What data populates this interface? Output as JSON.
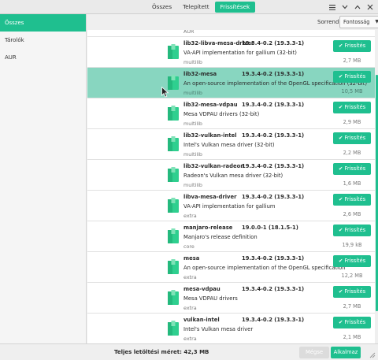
{
  "header": {
    "tabs": [
      {
        "label": "Összes",
        "active": false
      },
      {
        "label": "Telepített",
        "active": false
      },
      {
        "label": "Frissítések",
        "active": true
      }
    ],
    "window_buttons": [
      "menu-icon",
      "minimize-icon",
      "maximize-icon",
      "close-icon"
    ]
  },
  "sidebar": {
    "items": [
      {
        "label": "Összes",
        "active": true
      },
      {
        "label": "Tárolók",
        "active": false
      },
      {
        "label": "AUR",
        "active": false
      }
    ]
  },
  "sort": {
    "label": "Sorrend",
    "value": "Fontosság"
  },
  "packages": {
    "partial_repo_top": "AUR",
    "update_label": "Frissítés",
    "check_glyph": "✔",
    "items": [
      {
        "name": "lib32-libva-mesa-driver",
        "version": "19.3.4-0.2  (19.3.3-1)",
        "description": "VA-API implementation for gallium (32-bit)",
        "repo": "multilib",
        "size": "2,7 MB",
        "selected": false
      },
      {
        "name": "lib32-mesa",
        "version": "19.3.4-0.2  (19.3.3-1)",
        "description": "An open-source implementation of the OpenGL specification (32-bit)",
        "repo": "multilib",
        "size": "10,5 MB",
        "selected": true
      },
      {
        "name": "lib32-mesa-vdpau",
        "version": "19.3.4-0.2  (19.3.3-1)",
        "description": "Mesa VDPAU drivers (32-bit)",
        "repo": "multilib",
        "size": "2,9 MB",
        "selected": false
      },
      {
        "name": "lib32-vulkan-intel",
        "version": "19.3.4-0.2  (19.3.3-1)",
        "description": "Intel's Vulkan mesa driver (32-bit)",
        "repo": "multilib",
        "size": "2,2 MB",
        "selected": false
      },
      {
        "name": "lib32-vulkan-radeon",
        "version": "19.3.4-0.2  (19.3.3-1)",
        "description": "Radeon's Vulkan mesa driver (32-bit)",
        "repo": "multilib",
        "size": "1,6 MB",
        "selected": false
      },
      {
        "name": "libva-mesa-driver",
        "version": "19.3.4-0.2  (19.3.3-1)",
        "description": "VA-API implementation for gallium",
        "repo": "extra",
        "size": "2,6 MB",
        "selected": false
      },
      {
        "name": "manjaro-release",
        "version": "19.0.0-1  (18.1.5-1)",
        "description": "Manjaro's release definition",
        "repo": "core",
        "size": "19,9 kB",
        "selected": false
      },
      {
        "name": "mesa",
        "version": "19.3.4-0.2  (19.3.3-1)",
        "description": "An open-source implementation of the OpenGL specification",
        "repo": "extra",
        "size": "12,2 MB",
        "selected": false
      },
      {
        "name": "mesa-vdpau",
        "version": "19.3.4-0.2  (19.3.3-1)",
        "description": "Mesa VDPAU drivers",
        "repo": "extra",
        "size": "2,7 MB",
        "selected": false
      },
      {
        "name": "vulkan-intel",
        "version": "19.3.4-0.2  (19.3.3-1)",
        "description": "Intel's Vulkan mesa driver",
        "repo": "extra",
        "size": "2,1 MB",
        "selected": false
      }
    ]
  },
  "footer": {
    "total_label": "Teljes letöltési méret: 42,3 MB",
    "cancel_label": "Mégse",
    "apply_label": "Alkalmaz"
  },
  "colors": {
    "accent": "#1fbf8f",
    "selected_row": "#88d6c0"
  }
}
